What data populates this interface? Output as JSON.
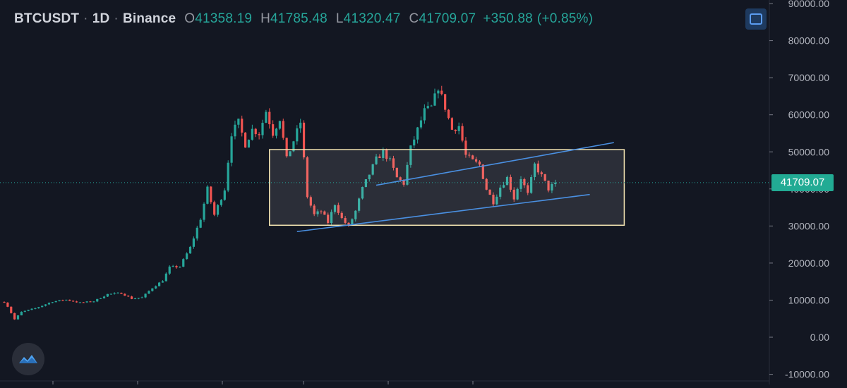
{
  "header": {
    "symbol": "BTCUSDT",
    "interval": "1D",
    "exchange": "Binance",
    "sep": "·",
    "open_key": "O",
    "open": "41358.19",
    "high_key": "H",
    "high": "41785.48",
    "low_key": "L",
    "low": "41320.47",
    "close_key": "C",
    "close": "41709.07",
    "change": "+350.88",
    "change_pct": "(+0.85%)"
  },
  "last_price_label": "41709.07",
  "colors": {
    "background": "#131722",
    "up": "#26a69a",
    "down": "#ef5350",
    "trendline": "#2962ff",
    "range_box": "#f5e6b3",
    "price_tag": "#22ab94"
  },
  "icons": {
    "maximize": "maximize-icon",
    "logo": "tradingview-cloud-icon"
  },
  "chart_data": {
    "type": "candlestick",
    "title": "BTCUSDT · 1D · Binance",
    "y_axis": {
      "ticks": [
        90000,
        80000,
        70000,
        60000,
        50000,
        40000,
        30000,
        20000,
        10000,
        0,
        -10000
      ],
      "tick_labels": [
        "90000.00",
        "80000.00",
        "70000.00",
        "60000.00",
        "50000.00",
        "40000.00",
        "30000.00",
        "20000.00",
        "10000.00",
        "0.00",
        "-10000.00"
      ],
      "ylim": [
        -11000,
        91000
      ],
      "position": "right"
    },
    "grid": false,
    "price_path": [
      [
        0,
        9500
      ],
      [
        1,
        8300
      ],
      [
        3,
        4800
      ],
      [
        5,
        6800
      ],
      [
        9,
        7800
      ],
      [
        14,
        9600
      ],
      [
        18,
        10100
      ],
      [
        22,
        9300
      ],
      [
        26,
        9700
      ],
      [
        30,
        11600
      ],
      [
        34,
        11900
      ],
      [
        37,
        10400
      ],
      [
        40,
        10700
      ],
      [
        43,
        13300
      ],
      [
        46,
        15300
      ],
      [
        48,
        18800
      ],
      [
        51,
        19100
      ],
      [
        54,
        24200
      ],
      [
        57,
        32000
      ],
      [
        59,
        40000
      ],
      [
        61,
        33000
      ],
      [
        64,
        40000
      ],
      [
        66,
        55000
      ],
      [
        68,
        58000
      ],
      [
        70,
        52000
      ],
      [
        72,
        56000
      ],
      [
        74,
        55000
      ],
      [
        76,
        61000
      ],
      [
        78,
        55000
      ],
      [
        80,
        59000
      ],
      [
        82,
        48000
      ],
      [
        84,
        53000
      ],
      [
        86,
        58000
      ],
      [
        88,
        38000
      ],
      [
        90,
        33000
      ],
      [
        92,
        34000
      ],
      [
        94,
        31000
      ],
      [
        96,
        36000
      ],
      [
        98,
        32000
      ],
      [
        100,
        29800
      ],
      [
        102,
        34000
      ],
      [
        104,
        40000
      ],
      [
        106,
        44000
      ],
      [
        108,
        48000
      ],
      [
        110,
        50000
      ],
      [
        112,
        47500
      ],
      [
        114,
        43000
      ],
      [
        116,
        41500
      ],
      [
        118,
        51000
      ],
      [
        120,
        56000
      ],
      [
        122,
        61000
      ],
      [
        124,
        62000
      ],
      [
        126,
        67500
      ],
      [
        128,
        62000
      ],
      [
        130,
        56000
      ],
      [
        132,
        57000
      ],
      [
        134,
        49000
      ],
      [
        136,
        47500
      ],
      [
        138,
        46500
      ],
      [
        140,
        40000
      ],
      [
        142,
        36500
      ],
      [
        144,
        40500
      ],
      [
        146,
        43000
      ],
      [
        148,
        37500
      ],
      [
        150,
        43000
      ],
      [
        152,
        38500
      ],
      [
        154,
        46500
      ],
      [
        156,
        43500
      ],
      [
        158,
        40000
      ],
      [
        160,
        41709
      ]
    ],
    "last_price": 41709.07,
    "annotations": {
      "range_box": {
        "x_start": 77,
        "x_end": 180,
        "y_top": 50600,
        "y_bottom": 30200
      },
      "upper_trendline": {
        "x1": 108,
        "y1": 41000,
        "x2": 177,
        "y2": 52500
      },
      "lower_trendline": {
        "x1": 85,
        "y1": 28500,
        "x2": 170,
        "y2": 38500
      },
      "last_price_line": 41709.07
    }
  }
}
